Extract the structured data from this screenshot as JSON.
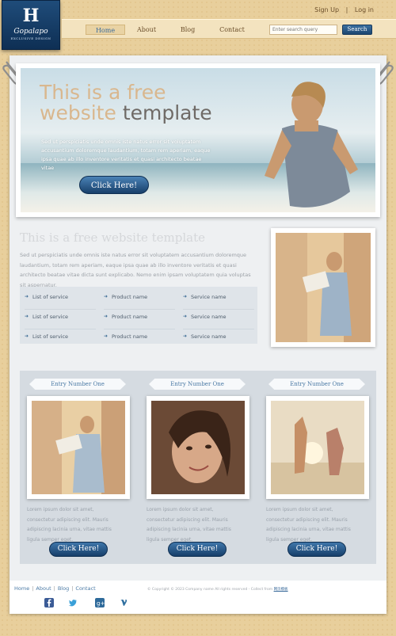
{
  "logo": {
    "mark": "H",
    "name": "Gopalapo",
    "tagline": "EXCLUSIVE DESIGN"
  },
  "top_links": {
    "signup": "Sign Up",
    "separator": "|",
    "login": "Log in"
  },
  "nav": {
    "items": [
      "Home",
      "About",
      "Blog",
      "Contact"
    ],
    "active": "Home",
    "search_placeholder": "Enter search query",
    "search_button": "Search"
  },
  "hero": {
    "title_line1": "This is a free",
    "title_line2_light": "website",
    "title_line2_dark": "template",
    "text": "Sed ut perspiciatis unde omnis iste natus error sit voluptatem accusantium doloremque laudantium, totam rem aperiam, eaque ipsa quae ab illo inventore veritatis et quasi architecto beatae vitae",
    "button": "Click Here!"
  },
  "intro": {
    "title": "This is a free website template",
    "text": "Sed ut perspiciatis unde omnis iste natus error sit voluptatem accusantium doloremque laudantium, totam rem aperiam, eaque ipsa quae ab illo inventore veritatis et quasi architecto beatae vitae dicta sunt explicabo. Nemo enim ipsam voluptatem quia voluptas sit aspernatur."
  },
  "lists": {
    "col1": [
      "List of service",
      "List of service",
      "List of service"
    ],
    "col2": [
      "Product name",
      "Product name",
      "Product name"
    ],
    "col3": [
      "Service name",
      "Service name",
      "Service name"
    ]
  },
  "entries": [
    {
      "title": "Entry Number One",
      "text": "Lorem ipsum dolor sit amet, consectetur adipiscing elit. Mauris adipiscing lacinia urna, vitae mattis ligula semper eget.",
      "button": "Click Here!"
    },
    {
      "title": "Entry Number One",
      "text": "Lorem ipsum dolor sit amet, consectetur adipiscing elit. Mauris adipiscing lacinia urna, vitae mattis ligula semper eget.",
      "button": "Click Here!"
    },
    {
      "title": "Entry Number One",
      "text": "Lorem ipsum dolor sit amet, consectetur adipiscing elit. Mauris adipiscing lacinia urna, vitae mattis ligula semper eget.",
      "button": "Click Here!"
    }
  ],
  "footer": {
    "links": [
      "Home",
      "About",
      "Blog",
      "Contact"
    ],
    "separator": "|",
    "copyright": "© Copyright © 2023 Company name All rights reserved - Collect from",
    "copyright_link": "网页模板",
    "social": [
      "facebook-icon",
      "twitter-icon",
      "google-plus-icon",
      "vimeo-icon"
    ]
  },
  "colors": {
    "accent": "#1d4670",
    "link": "#4b7aa5",
    "background": "#e8cf9c"
  }
}
